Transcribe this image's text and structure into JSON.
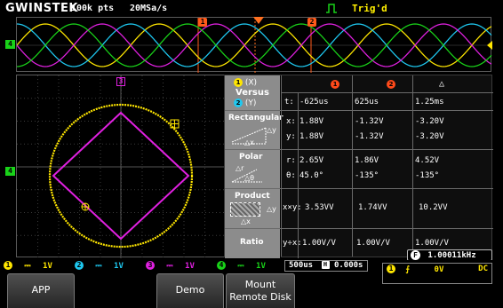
{
  "topbar": {
    "logo": "GWINSTEK",
    "record_length": "100k pts",
    "sample_rate": "20MSa/s",
    "trigger_status": "Trig'd"
  },
  "overview": {
    "cursor1_label": "1",
    "cursor2_label": "2",
    "ch4_marker": "4"
  },
  "graticule": {
    "ch3_marker": "3",
    "ch4_marker": "4"
  },
  "table": {
    "header": {
      "versus_x_badge": "1",
      "versus_x_suffix": "(X)",
      "versus_title": "Versus",
      "versus_y_badge": "2",
      "versus_y_suffix": "(Y)",
      "col1": "1",
      "col2": "2",
      "col3": "△"
    },
    "time_row": {
      "label": "t:",
      "v1": "-625us",
      "v2": "625us",
      "v3": "1.25ms"
    },
    "rectangular": {
      "title": "Rectangular",
      "dy": "△y",
      "dx": "△x",
      "x_label": "x:",
      "x_v1": "1.88V",
      "x_v2": "-1.32V",
      "x_v3": "-3.20V",
      "y_label": "y:",
      "y_v1": "1.88V",
      "y_v2": "-1.32V",
      "y_v3": "-3.20V"
    },
    "polar": {
      "title": "Polar",
      "dr": "△r",
      "dtheta": "△θ",
      "r_label": "r:",
      "r_v1": "2.65V",
      "r_v2": "1.86V",
      "r_v3": "4.52V",
      "t_label": "θ:",
      "t_v1": "45.0°",
      "t_v2": "-135°",
      "t_v3": "-135°"
    },
    "product": {
      "title": "Product",
      "dy": "△y",
      "dx": "△x",
      "label": "x×y:",
      "v1": "3.53VV",
      "v2": "1.74VV",
      "v3": "10.2VV"
    },
    "ratio": {
      "title": "Ratio",
      "label": "y÷x:",
      "v1": "1.00V/V",
      "v2": "1.00V/V",
      "v3": "1.00V/V"
    }
  },
  "frequency": {
    "icon_label": "F",
    "value": "1.00011kHz"
  },
  "channels": [
    {
      "num": "1",
      "coupling": "⎓",
      "scale": "1V",
      "color": "#ffe600"
    },
    {
      "num": "2",
      "coupling": "⎓",
      "scale": "1V",
      "color": "#1ec8f0"
    },
    {
      "num": "3",
      "coupling": "⎓",
      "scale": "1V",
      "color": "#e020e0"
    },
    {
      "num": "4",
      "coupling": "⎓",
      "scale": "1V",
      "color": "#19d219"
    }
  ],
  "timebase": {
    "scale": "500us",
    "h_label": "H",
    "position": "0.000s"
  },
  "trigger": {
    "source": "1",
    "slope": "⨍",
    "level": "0V",
    "coupling": "DC"
  },
  "softkeys": {
    "app": "APP",
    "demo": "Demo",
    "mount_line1": "Mount",
    "mount_line2": "Remote Disk"
  }
}
